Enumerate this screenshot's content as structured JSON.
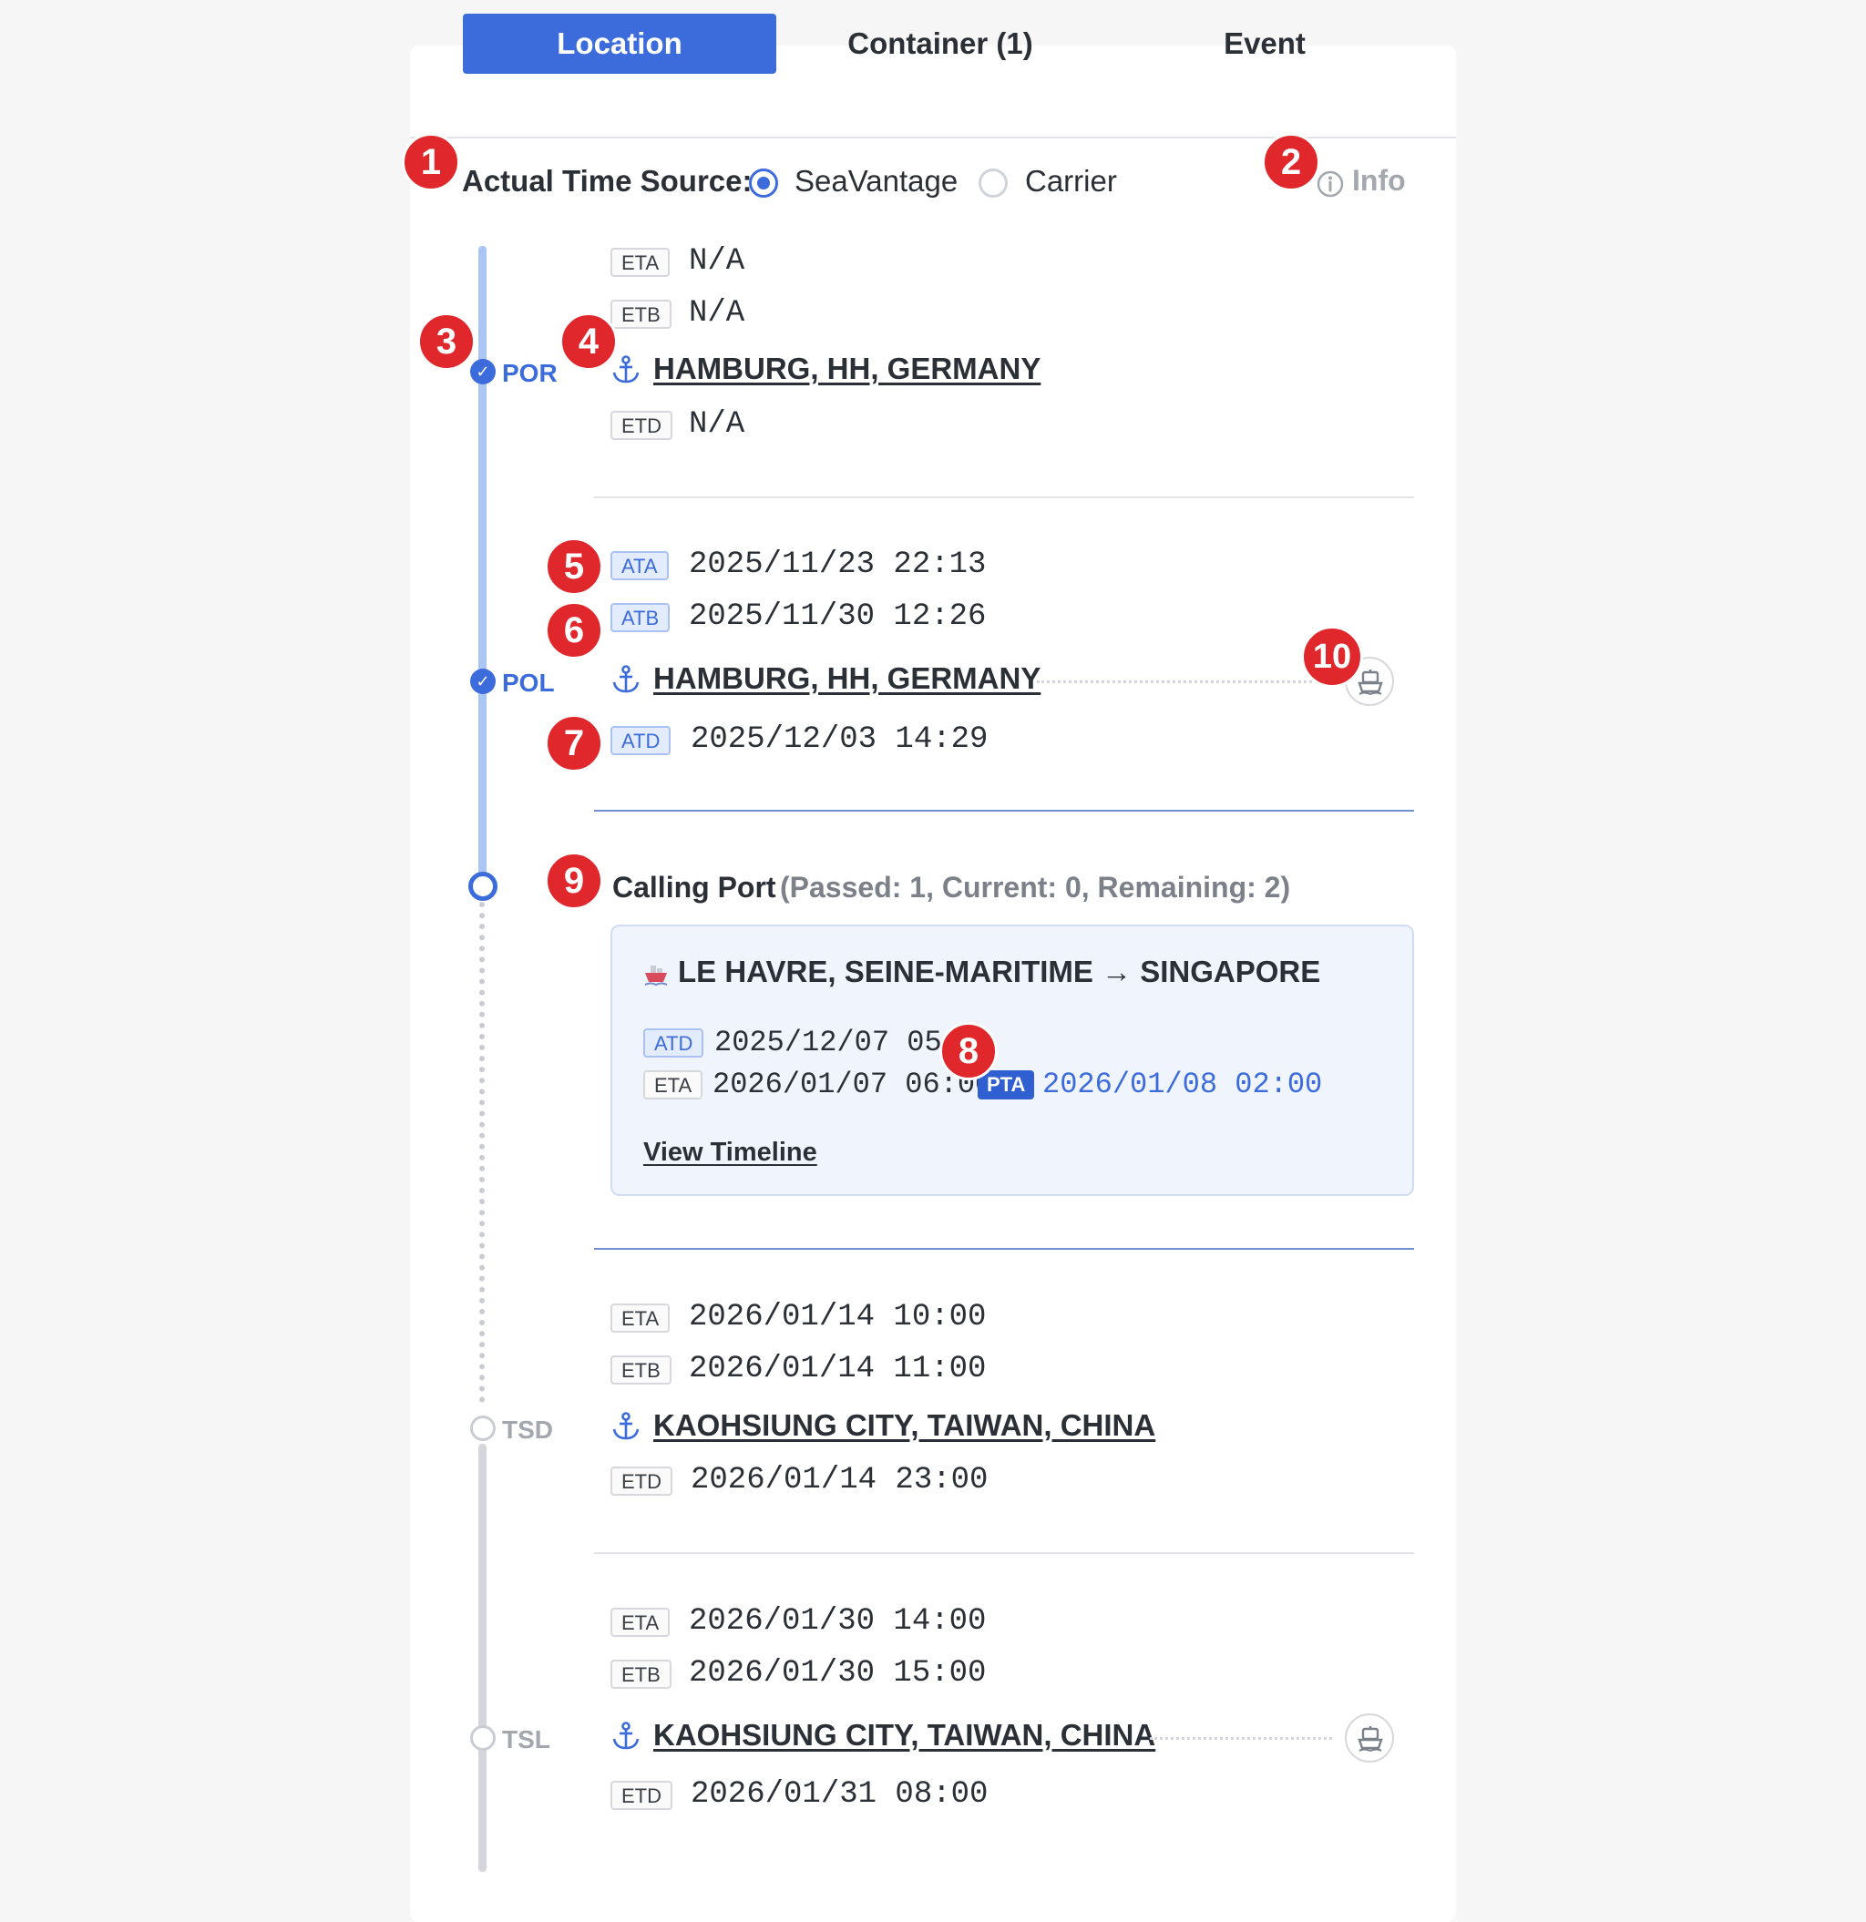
{
  "tabs": [
    "Location",
    "Container (1)",
    "Event"
  ],
  "source": {
    "label": "Actual Time Source:",
    "options": [
      "SeaVantage",
      "Carrier"
    ],
    "selected": "SeaVantage",
    "info": "Info"
  },
  "stops": [
    {
      "code": "POR",
      "status": "passed",
      "port": "HAMBURG, HH, GERMANY",
      "times": [
        {
          "type": "ETA",
          "value": "N/A"
        },
        {
          "type": "ETB",
          "value": "N/A"
        },
        {
          "type": "ETD",
          "value": "N/A"
        }
      ]
    },
    {
      "code": "POL",
      "status": "passed",
      "port": "HAMBURG, HH, GERMANY",
      "times": [
        {
          "type": "ATA",
          "value": "2025/11/23 22:13"
        },
        {
          "type": "ATB",
          "value": "2025/11/30 12:26"
        },
        {
          "type": "ATD",
          "value": "2025/12/03 14:29"
        }
      ]
    },
    {
      "code": "TSD",
      "status": "pending",
      "port": "KAOHSIUNG CITY, TAIWAN, CHINA",
      "times": [
        {
          "type": "ETA",
          "value": "2026/01/14 10:00"
        },
        {
          "type": "ETB",
          "value": "2026/01/14 11:00"
        },
        {
          "type": "ETD",
          "value": "2026/01/14 23:00"
        }
      ]
    },
    {
      "code": "TSL",
      "status": "pending",
      "port": "KAOHSIUNG CITY, TAIWAN, CHINA",
      "times": [
        {
          "type": "ETA",
          "value": "2026/01/30 14:00"
        },
        {
          "type": "ETB",
          "value": "2026/01/30 15:00"
        },
        {
          "type": "ETD",
          "value": "2026/01/31 08:00"
        }
      ]
    }
  ],
  "calling": {
    "title": "Calling Port",
    "counts": "(Passed: 1, Current: 0, Remaining: 2)",
    "route": "LE HAVRE, SEINE-MARITIME → SINGAPORE",
    "atd_label": "ATD",
    "atd": "2025/12/07 05:2",
    "eta_label": "ETA",
    "eta": "2026/01/07 06:00",
    "pta_label": "PTA",
    "pta": "2026/01/08 02:00",
    "view_timeline": "View Timeline"
  },
  "markers": [
    "1",
    "2",
    "3",
    "4",
    "5",
    "6",
    "7",
    "8",
    "9",
    "10"
  ],
  "colors": {
    "accent": "#3c6cdc",
    "marker": "#e0272c",
    "timeline_done": "#a9c6f5",
    "timeline_pending": "#d4d6db"
  },
  "icons": {
    "port": "anchor-icon",
    "vessel": "ship-icon",
    "info": "info-circle-icon",
    "check": "check-circle-icon"
  }
}
